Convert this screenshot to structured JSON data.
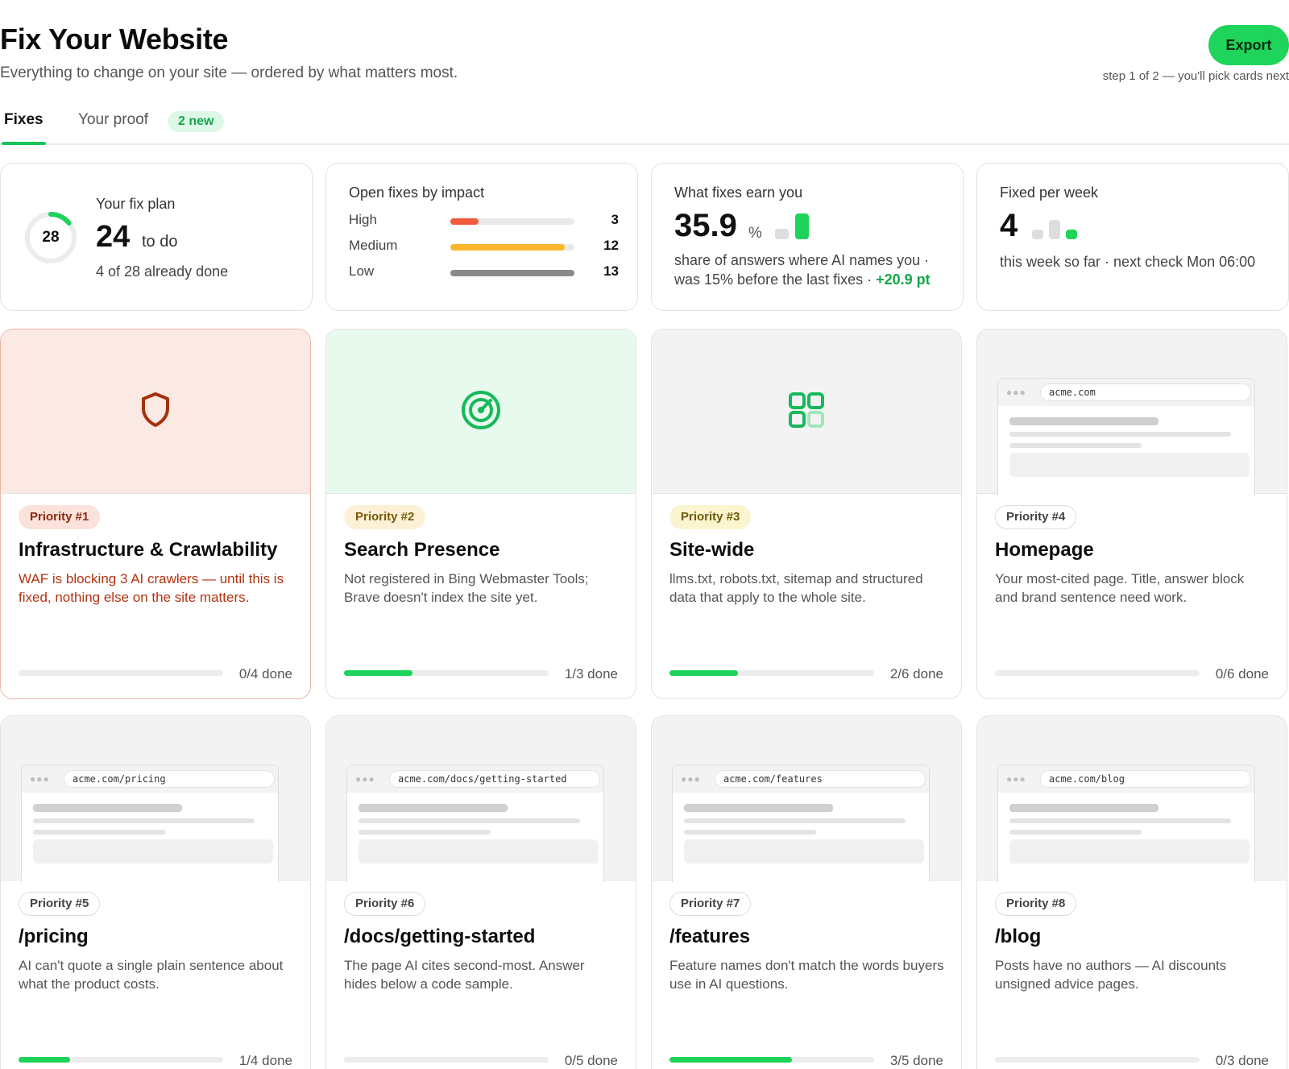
{
  "header": {
    "title": "Fix Your Website",
    "subtitle": "Everything to change on your site — ordered by what matters most.",
    "export_label": "Export",
    "step_note": "step 1 of 2 — you'll pick cards next"
  },
  "tabs": {
    "fixes": "Fixes",
    "proof": "Your proof",
    "proof_badge": "2 new"
  },
  "stats": {
    "plan": {
      "label": "Your fix plan",
      "ring_total": "28",
      "todo_count": "24",
      "todo_label": "to do",
      "done_text": "4 of 28 already done",
      "done_fraction": 0.142857
    },
    "impact": {
      "label": "Open fixes by impact",
      "rows": [
        {
          "name": "High",
          "value": "3",
          "fraction": 0.23,
          "color": "#f25a3c"
        },
        {
          "name": "Medium",
          "value": "12",
          "fraction": 0.92,
          "color": "#fbb72c"
        },
        {
          "name": "Low",
          "value": "13",
          "fraction": 1.0,
          "color": "#8a8a8a"
        }
      ]
    },
    "earn": {
      "label": "What fixes earn you",
      "value": "35.9",
      "unit": "%",
      "line1": "share of answers where AI names you ·",
      "line2": "was 15% before the last fixes ·",
      "delta": "+20.9 pt",
      "bar_values": [
        15,
        35.9
      ],
      "bar_colors": [
        "#dddddd",
        "#1dd35a"
      ]
    },
    "week": {
      "label": "Fixed per week",
      "value": "4",
      "note": "this week so far · next check Mon 06:00",
      "bar_values": [
        1,
        2,
        1
      ],
      "bar_colors": [
        "#dddddd",
        "#dddddd",
        "#1dd35a"
      ]
    }
  },
  "cards": [
    {
      "priority": "Priority #1",
      "title": "Infrastructure & Crawlability",
      "desc": "WAF is blocking 3 AI crawlers — until this is fixed, nothing else on the site matters.",
      "progress": "0/4 done",
      "done": 0,
      "total": 4,
      "hero": "shield-icon",
      "hero_bg": "#fbe9e4",
      "pill_bg": "#fbe2da",
      "pill_color": "#8a2a0f",
      "critical": true
    },
    {
      "priority": "Priority #2",
      "title": "Search Presence",
      "desc": "Not registered in Bing Webmaster Tools; Brave doesn't index the site yet.",
      "progress": "1/3 done",
      "done": 1,
      "total": 3,
      "hero": "target-icon",
      "hero_bg": "#e8faee",
      "pill_bg": "#fcf1d6",
      "pill_color": "#7a5a0a"
    },
    {
      "priority": "Priority #3",
      "title": "Site-wide",
      "desc": "llms.txt, robots.txt, sitemap and structured data that apply to the whole site.",
      "progress": "2/6 done",
      "done": 2,
      "total": 6,
      "hero": "grid-icon",
      "hero_bg": "#f3f3f3",
      "pill_bg": "#faf4cf",
      "pill_color": "#6e5a08"
    },
    {
      "priority": "Priority #4",
      "title": "Homepage",
      "desc": "Your most-cited page. Title, answer block and brand sentence need work.",
      "progress": "0/6 done",
      "done": 0,
      "total": 6,
      "hero": "browser",
      "url": "acme.com",
      "hero_bg": "#f3f3f3"
    },
    {
      "priority": "Priority #5",
      "title": "/pricing",
      "desc": "AI can't quote a single plain sentence about what the product costs.",
      "progress": "1/4 done",
      "done": 1,
      "total": 4,
      "hero": "browser",
      "url": "acme.com/pricing",
      "hero_bg": "#f3f3f3"
    },
    {
      "priority": "Priority #6",
      "title": "/docs/getting-started",
      "desc": "The page AI cites second-most. Answer hides below a code sample.",
      "progress": "0/5 done",
      "done": 0,
      "total": 5,
      "hero": "browser",
      "url": "acme.com/docs/getting-started",
      "hero_bg": "#f3f3f3"
    },
    {
      "priority": "Priority #7",
      "title": "/features",
      "desc": "Feature names don't match the words buyers use in AI questions.",
      "progress": "3/5 done",
      "done": 3,
      "total": 5,
      "hero": "browser",
      "url": "acme.com/features",
      "hero_bg": "#f3f3f3"
    },
    {
      "priority": "Priority #8",
      "title": "/blog",
      "desc": "Posts have no authors — AI discounts unsigned advice pages.",
      "progress": "0/3 done",
      "done": 0,
      "total": 3,
      "hero": "browser",
      "url": "acme.com/blog",
      "hero_bg": "#f3f3f3"
    }
  ]
}
